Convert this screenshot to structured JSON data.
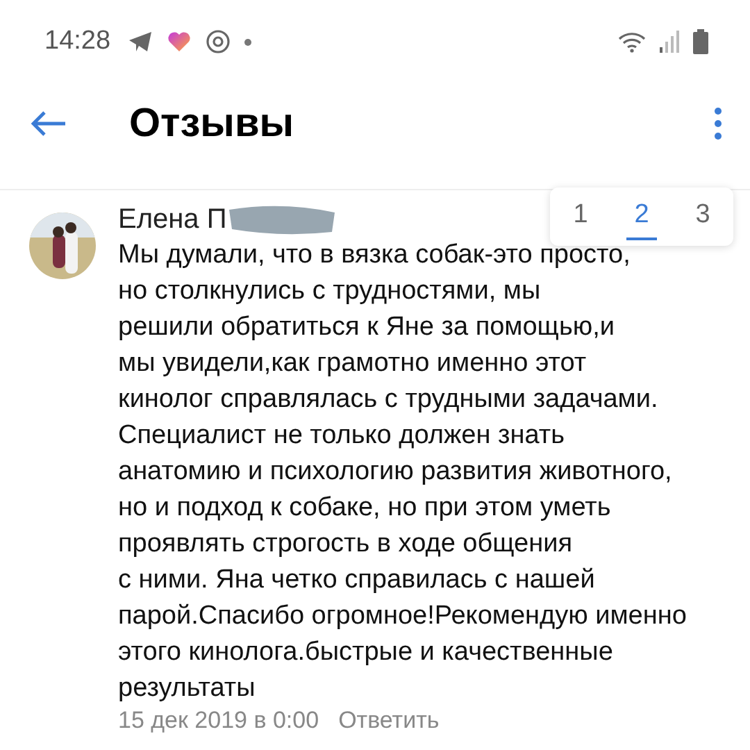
{
  "status_bar": {
    "time": "14:28"
  },
  "header": {
    "title": "Отзывы"
  },
  "pagination": [
    {
      "label": "1",
      "selected": false
    },
    {
      "label": "2",
      "selected": true
    },
    {
      "label": "3",
      "selected": false
    }
  ],
  "comment": {
    "author": "Елена П",
    "author_redacted": true,
    "text": "Мы думали, что в вязка собак-это просто,\nно столкнулись с трудностями, мы\nрешили обратиться к Яне за помощью,и\nмы увидели,как грамотно именно этот\nкинолог справлялась с трудными задачами.\nСпециалист не только должен знать\nанатомию и психологию развития животного,\nно и подход к собаке, но при этом уметь\nпроявлять строгость в ходе общения\nс ними. Яна четко справилась с нашей\nпарой.Спасибо огромное!Рекомендую именно\nэтого кинолога.быстрые и качественные\nрезультаты",
    "date": "15 дек 2019 в 0:00",
    "reply": "Ответить"
  }
}
